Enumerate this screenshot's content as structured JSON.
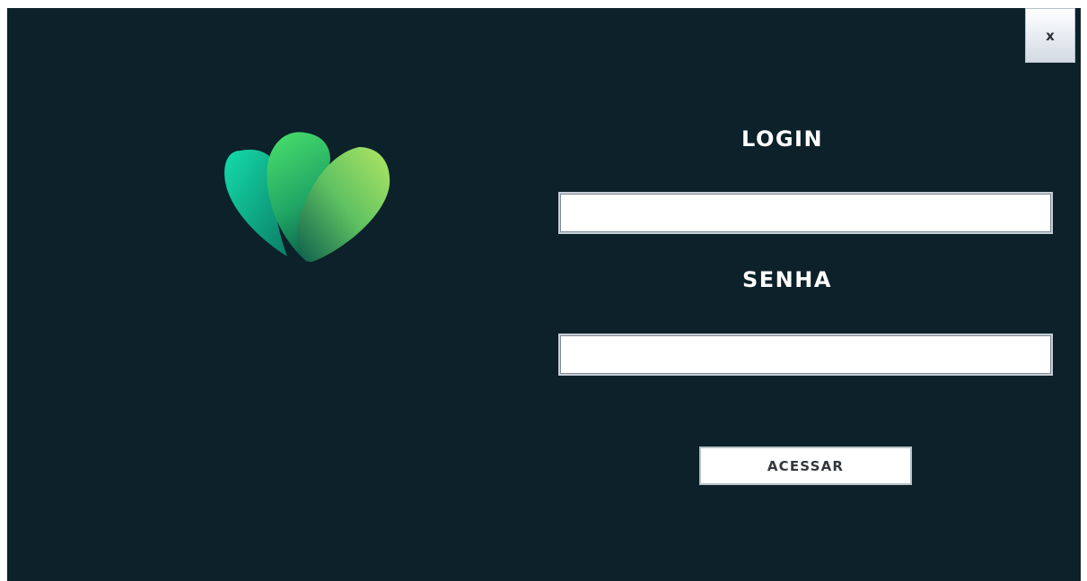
{
  "window": {
    "background": "#0c2129"
  },
  "close_button": {
    "label": "x"
  },
  "logo": {
    "icon": "leaf-heart-logo",
    "colors": [
      "#13d6a4",
      "#3fd46a",
      "#a7e063",
      "#0a5a4a"
    ]
  },
  "login": {
    "label": "LOGIN",
    "value": "",
    "placeholder": ""
  },
  "password": {
    "label": "SENHA",
    "value": "",
    "placeholder": ""
  },
  "access_button": {
    "label": "ACESSAR"
  }
}
